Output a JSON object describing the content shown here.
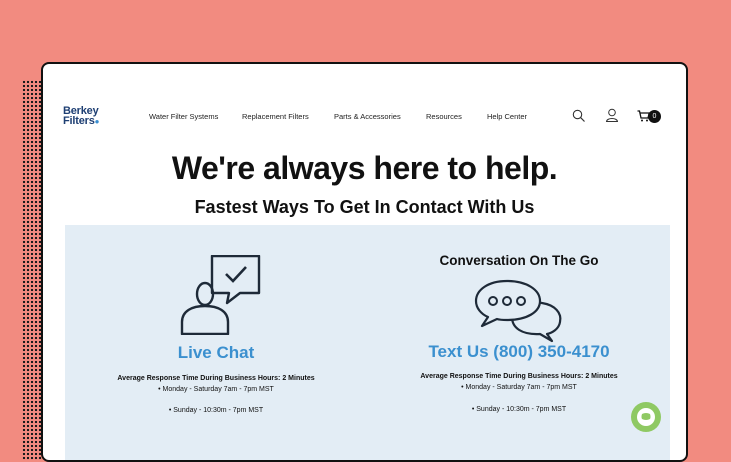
{
  "brand": {
    "line1": "Berkey",
    "line2": "Filters"
  },
  "nav": {
    "items": [
      {
        "label": "Water Filter Systems"
      },
      {
        "label": "Replacement Filters"
      },
      {
        "label": "Parts & Accessories"
      },
      {
        "label": "Resources"
      },
      {
        "label": "Help Center"
      }
    ],
    "cart_count": "0"
  },
  "hero": {
    "title": "We're always here to help.",
    "subtitle": "Fastest Ways To Get In Contact With Us"
  },
  "contact": {
    "live_chat": {
      "label": "Live Chat",
      "response": "Average Response Time During Business Hours: 2 Minutes",
      "weekday": "• Monday - Saturday 7am - 7pm MST",
      "sunday": "• Sunday - 10:30m - 7pm MST"
    },
    "text": {
      "heading": "Conversation On The Go",
      "label": "Text Us (800) 350-4170",
      "response": "Average Response Time During Business Hours: 2 Minutes",
      "weekday": "• Monday - Saturday 7am - 7pm MST",
      "sunday": "• Sunday - 10:30m - 7pm MST"
    }
  },
  "colors": {
    "background": "#f28b80",
    "panel": "#e3edf5",
    "link_blue": "#3b90cf",
    "brand_navy": "#1e3f73",
    "chat_fab": "#8fc963"
  }
}
